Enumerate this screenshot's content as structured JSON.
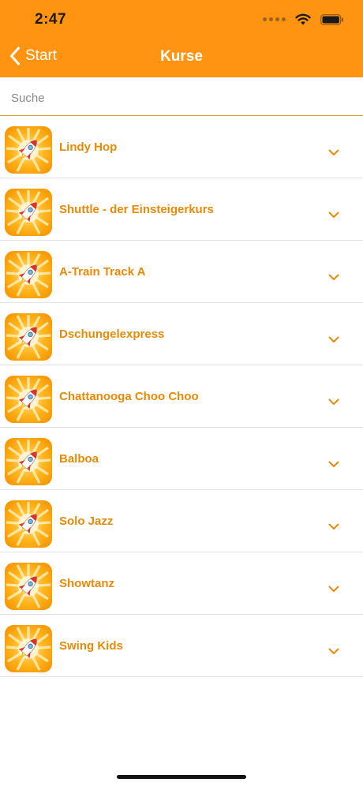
{
  "status_bar": {
    "time": "2:47"
  },
  "nav": {
    "back_label": "Start",
    "title": "Kurse"
  },
  "search": {
    "placeholder": "Suche",
    "value": ""
  },
  "courses": [
    {
      "label": "Lindy Hop",
      "icon": "rocket-app-icon"
    },
    {
      "label": "Shuttle - der Einsteigerkurs",
      "icon": "rocket-app-icon"
    },
    {
      "label": "A-Train Track A",
      "icon": "rocket-app-icon"
    },
    {
      "label": "Dschungelexpress",
      "icon": "rocket-app-icon"
    },
    {
      "label": "Chattanooga Choo Choo",
      "icon": "rocket-app-icon"
    },
    {
      "label": "Balboa",
      "icon": "rocket-app-icon"
    },
    {
      "label": "Solo Jazz",
      "icon": "rocket-app-icon"
    },
    {
      "label": "Showtanz",
      "icon": "rocket-app-icon"
    },
    {
      "label": "Swing Kids",
      "icon": "rocket-app-icon"
    }
  ],
  "colors": {
    "header": "#FF9412",
    "accent_text": "#E88A06",
    "search_underline": "#D8A13A"
  }
}
